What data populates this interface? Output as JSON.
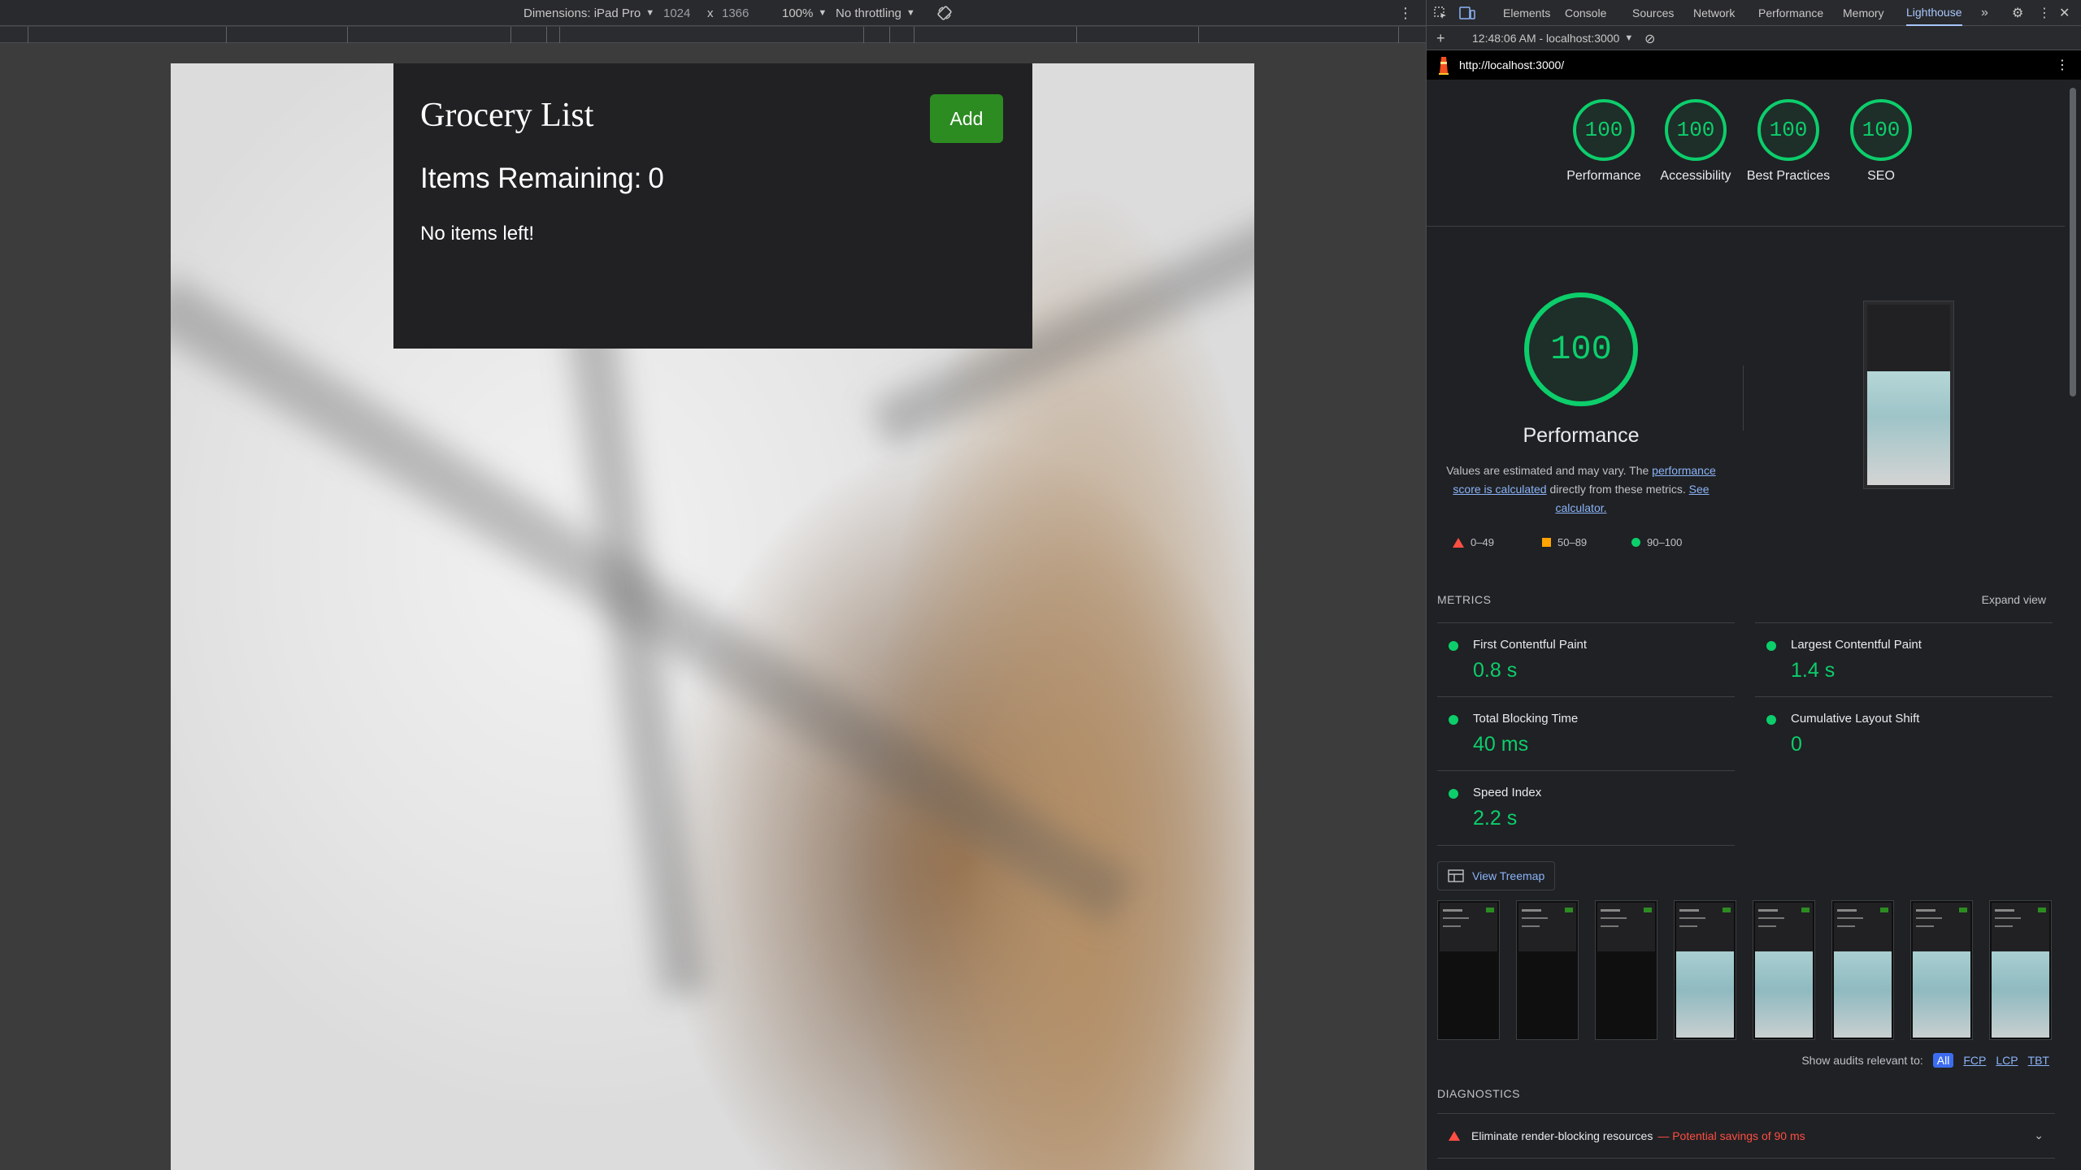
{
  "device_toolbar": {
    "dimensions_label": "Dimensions: iPad Pro",
    "width": "1024",
    "times": "x",
    "height": "1366",
    "zoom": "100%",
    "throttling": "No throttling"
  },
  "app": {
    "title": "Grocery List",
    "add_label": "Add",
    "items_remaining_label": "Items Remaining:",
    "items_remaining_count": "0",
    "empty_message": "No items left!"
  },
  "devtools": {
    "tabs": [
      "Elements",
      "Console",
      "Sources",
      "Network",
      "Performance",
      "Memory",
      "Lighthouse"
    ],
    "active_tab": "Lighthouse",
    "report_selector": "12:48:06 AM - localhost:3000",
    "url": "http://localhost:3000/"
  },
  "scores": [
    {
      "label": "Performance",
      "value": "100"
    },
    {
      "label": "Accessibility",
      "value": "100"
    },
    {
      "label": "Best Practices",
      "value": "100"
    },
    {
      "label": "SEO",
      "value": "100"
    }
  ],
  "performance": {
    "score": "100",
    "title": "Performance",
    "desc_1": "Values are estimated and may vary. The ",
    "desc_link_1": "performance score is calculated",
    "desc_2": " directly from these metrics. ",
    "desc_link_2": "See calculator.",
    "legend": [
      "0–49",
      "50–89",
      "90–100"
    ]
  },
  "metrics": {
    "heading": "METRICS",
    "expand_label": "Expand view",
    "items": [
      {
        "label": "First Contentful Paint",
        "value": "0.8 s"
      },
      {
        "label": "Largest Contentful Paint",
        "value": "1.4 s"
      },
      {
        "label": "Total Blocking Time",
        "value": "40 ms"
      },
      {
        "label": "Cumulative Layout Shift",
        "value": "0"
      },
      {
        "label": "Speed Index",
        "value": "2.2 s"
      }
    ]
  },
  "treemap_label": "View Treemap",
  "filter": {
    "label": "Show audits relevant to:",
    "options": [
      "All",
      "FCP",
      "LCP",
      "TBT"
    ],
    "active": "All"
  },
  "diagnostics": {
    "heading": "DIAGNOSTICS",
    "item_title": "Eliminate render-blocking resources",
    "item_savings": "— Potential savings of 90 ms"
  },
  "colors": {
    "pass": "#0cce6b",
    "average": "#ffa400",
    "fail": "#ff4e42",
    "add_button": "#2c8c22",
    "card_bg": "#212123"
  }
}
